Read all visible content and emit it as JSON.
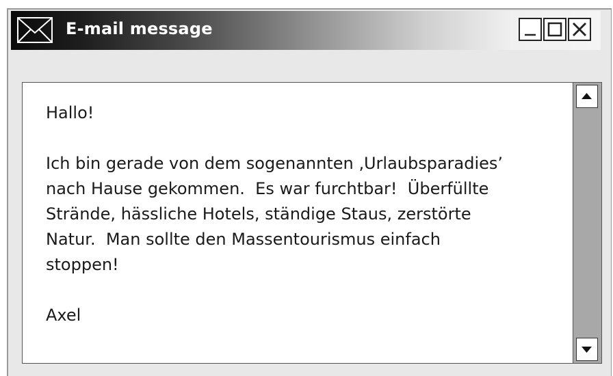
{
  "window": {
    "title": "E-mail message",
    "icon": "envelope-icon",
    "controls": {
      "minimize": "_",
      "maximize": "□",
      "close": "X"
    }
  },
  "message": {
    "lines": [
      "Hallo!",
      "",
      "Ich bin gerade von dem sogenannten ‚Urlaubsparadies’",
      "nach Hause gekommen.  Es war furchtbar!  Überfüllte",
      "Strände, hässliche Hotels, ständige Staus, zerstörte",
      "Natur.  Man sollte den Massentourismus einfach",
      "stoppen!",
      "",
      "Axel"
    ]
  },
  "scrollbar": {
    "up_icon": "arrow-up-icon",
    "down_icon": "arrow-down-icon"
  },
  "colors": {
    "titlebar_start": "#0a0a0a",
    "titlebar_end": "#f4f4f4",
    "window_bg": "#e8e8e8",
    "scroll_track": "#a8a8a8",
    "text": "#1a1a1a"
  }
}
